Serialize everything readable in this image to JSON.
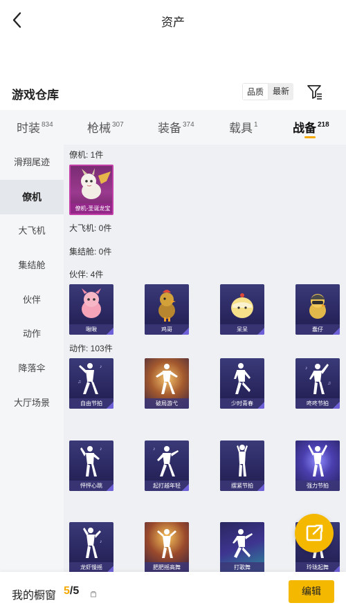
{
  "nav": {
    "title": "资产"
  },
  "warehouse": {
    "title": "游戏仓库",
    "sort_options": [
      "品质",
      "最新"
    ],
    "active_sort": "品质"
  },
  "tabs": [
    {
      "label": "时装",
      "count": "834",
      "active": false
    },
    {
      "label": "枪械",
      "count": "307",
      "active": false
    },
    {
      "label": "装备",
      "count": "374",
      "active": false
    },
    {
      "label": "载具",
      "count": "1",
      "active": false
    },
    {
      "label": "战备",
      "count": "218",
      "active": true
    }
  ],
  "sidebar": {
    "items": [
      "滑翔尾迹",
      "僚机",
      "大飞机",
      "集结舱",
      "伙伴",
      "动作",
      "降落伞",
      "大厅场景"
    ],
    "active": "僚机"
  },
  "groups": {
    "wingman": {
      "label": "僚机: 1件",
      "items": [
        "僚机-圣诞龙宝"
      ]
    },
    "big_plane": {
      "label": "大飞机: 0件"
    },
    "assembly_pod": {
      "label": "集结舱: 0件"
    },
    "companion": {
      "label": "伙伴: 4件",
      "items": [
        "啾啾",
        "鸡哥",
        "呆呆",
        "蠢仔"
      ]
    },
    "emote": {
      "label": "动作: 103件",
      "items": [
        "自由节拍",
        "破局游弋",
        "少时青春",
        "咚咚节拍",
        "怦怦心跳",
        "起打越年轻",
        "摆紧节拍",
        "强力节拍",
        "龙虾慢摇",
        "肥肥摇高舞",
        "打歌舞",
        "玲珑起舞"
      ]
    }
  },
  "bottom": {
    "window_label": "我的橱窗",
    "count_current": "5",
    "count_separator": "/",
    "count_max": "5",
    "edit_label": "编辑"
  },
  "colors": {
    "accent": "#f5b800",
    "indicator": "#f5a800",
    "card_bg": "#2a2760",
    "card_rare": "#9b3a8f"
  }
}
